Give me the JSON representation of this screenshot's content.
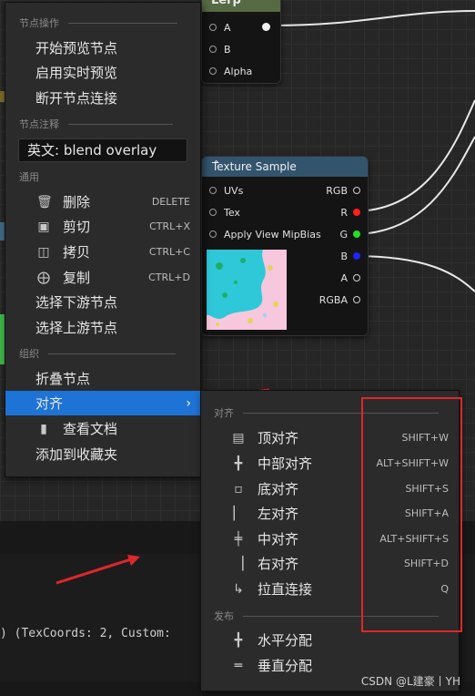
{
  "lerp_node": {
    "title": "Lerp",
    "pins": [
      "A",
      "B",
      "Alpha"
    ]
  },
  "texture_node": {
    "title": "Texture Sample",
    "inputs": [
      "UVs",
      "Tex",
      "Apply View MipBias"
    ],
    "outputs": [
      "RGB",
      "R",
      "G",
      "B",
      "A",
      "RGBA"
    ],
    "colors": {
      "R": "#ff1f1f",
      "G": "#22e022",
      "B": "#2222ff"
    }
  },
  "context_menu": {
    "section_node_ops": "节点操作",
    "start_preview": "开始预览节点",
    "enable_live_preview": "启用实时预览",
    "break_links": "断开节点连接",
    "section_comment": "节点注释",
    "comment_value": "英文: blend overlay",
    "section_general": "通用",
    "delete": {
      "label": "删除",
      "shortcut": "DELETE"
    },
    "cut": {
      "label": "剪切",
      "shortcut": "CTRL+X"
    },
    "copy": {
      "label": "拷贝",
      "shortcut": "CTRL+C"
    },
    "duplicate": {
      "label": "复制",
      "shortcut": "CTRL+D"
    },
    "select_downstream": "选择下游节点",
    "select_upstream": "选择上游节点",
    "section_organize": "组织",
    "collapse": "折叠节点",
    "align": "对齐",
    "view_docs": "查看文档",
    "add_favorites": "添加到收藏夹"
  },
  "align_submenu": {
    "section_align": "对齐",
    "items": [
      {
        "label": "顶对齐",
        "shortcut": "SHIFT+W"
      },
      {
        "label": "中部对齐",
        "shortcut": "ALT+SHIFT+W"
      },
      {
        "label": "底对齐",
        "shortcut": "SHIFT+S"
      },
      {
        "label": "左对齐",
        "shortcut": "SHIFT+A"
      },
      {
        "label": "中对齐",
        "shortcut": "ALT+SHIFT+S"
      },
      {
        "label": "右对齐",
        "shortcut": "SHIFT+D"
      },
      {
        "label": "拉直连接",
        "shortcut": "Q"
      }
    ],
    "section_distribute": "发布",
    "distribute_items": [
      {
        "label": "水平分配"
      },
      {
        "label": "垂直分配"
      }
    ]
  },
  "code_text": ") (TexCoords: 2, Custom:",
  "watermark": "CSDN @L建豪丨YH",
  "accent": "#1e73d6",
  "annotation_color": "#e0262b"
}
